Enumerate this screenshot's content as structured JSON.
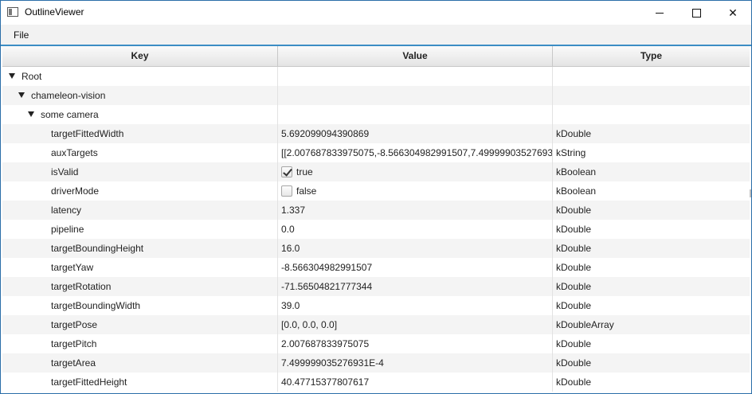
{
  "window": {
    "title": "OutlineViewer"
  },
  "menu": {
    "file": "File"
  },
  "columns": {
    "key": "Key",
    "value": "Value",
    "type": "Type"
  },
  "rows": [
    {
      "key": "Root",
      "value": "",
      "type": "",
      "indent": 0,
      "expanded": true
    },
    {
      "key": "chameleon-vision",
      "value": "",
      "type": "",
      "indent": 1,
      "expanded": true
    },
    {
      "key": "some camera",
      "value": "",
      "type": "",
      "indent": 2,
      "expanded": true
    },
    {
      "key": "targetFittedWidth",
      "value": "5.692099094390869",
      "type": "kDouble",
      "indent": 3
    },
    {
      "key": "auxTargets",
      "value": "[[2.007687833975075,-8.566304982991507,7.49999903527693...",
      "type": "kString",
      "indent": 3
    },
    {
      "key": "isValid",
      "value": "true",
      "type": "kBoolean",
      "indent": 3,
      "checkbox": true,
      "checked": true
    },
    {
      "key": "driverMode",
      "value": "false",
      "type": "kBoolean",
      "indent": 3,
      "checkbox": true,
      "checked": false
    },
    {
      "key": "latency",
      "value": "1.337",
      "type": "kDouble",
      "indent": 3
    },
    {
      "key": "pipeline",
      "value": "0.0",
      "type": "kDouble",
      "indent": 3
    },
    {
      "key": "targetBoundingHeight",
      "value": "16.0",
      "type": "kDouble",
      "indent": 3
    },
    {
      "key": "targetYaw",
      "value": "-8.566304982991507",
      "type": "kDouble",
      "indent": 3
    },
    {
      "key": "targetRotation",
      "value": "-71.56504821777344",
      "type": "kDouble",
      "indent": 3
    },
    {
      "key": "targetBoundingWidth",
      "value": "39.0",
      "type": "kDouble",
      "indent": 3
    },
    {
      "key": "targetPose",
      "value": "[0.0, 0.0, 0.0]",
      "type": "kDoubleArray",
      "indent": 3
    },
    {
      "key": "targetPitch",
      "value": "2.007687833975075",
      "type": "kDouble",
      "indent": 3
    },
    {
      "key": "targetArea",
      "value": "7.499999035276931E-4",
      "type": "kDouble",
      "indent": 3
    },
    {
      "key": "targetFittedHeight",
      "value": "40.47715377807617",
      "type": "kDouble",
      "indent": 3
    }
  ]
}
